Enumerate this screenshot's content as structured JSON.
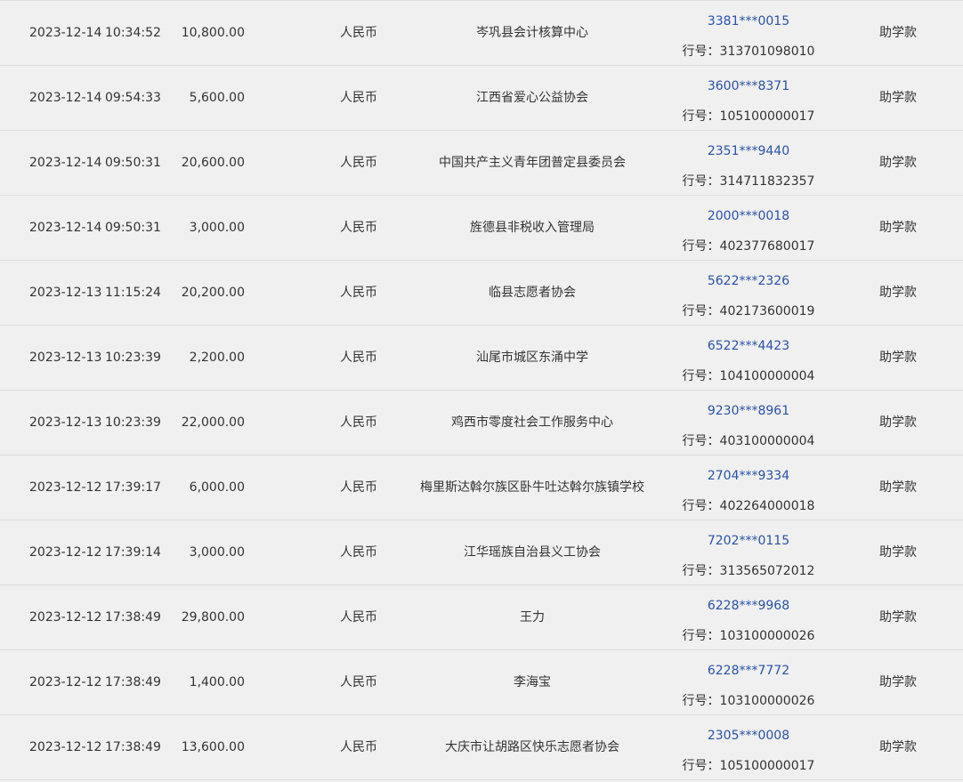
{
  "bank_label": "行号：",
  "colors": {
    "account_link": "#2852a8",
    "text": "#333333",
    "background": "#f0f0f0",
    "divider": "#dcdcdc"
  },
  "rows": [
    {
      "date": "2023-12-14",
      "time": "10:34:52",
      "amount": "10,800.00",
      "currency": "人民币",
      "name": "岑巩县会计核算中心",
      "account": "3381***0015",
      "bank_no": "313701098010",
      "purpose": "助学款"
    },
    {
      "date": "2023-12-14",
      "time": "09:54:33",
      "amount": "5,600.00",
      "currency": "人民币",
      "name": "江西省爱心公益协会",
      "account": "3600***8371",
      "bank_no": "105100000017",
      "purpose": "助学款"
    },
    {
      "date": "2023-12-14",
      "time": "09:50:31",
      "amount": "20,600.00",
      "currency": "人民币",
      "name": "中国共产主义青年团普定县委员会",
      "account": "2351***9440",
      "bank_no": "314711832357",
      "purpose": "助学款"
    },
    {
      "date": "2023-12-14",
      "time": "09:50:31",
      "amount": "3,000.00",
      "currency": "人民币",
      "name": "旌德县非税收入管理局",
      "account": "2000***0018",
      "bank_no": "402377680017",
      "purpose": "助学款"
    },
    {
      "date": "2023-12-13",
      "time": "11:15:24",
      "amount": "20,200.00",
      "currency": "人民币",
      "name": "临县志愿者协会",
      "account": "5622***2326",
      "bank_no": "402173600019",
      "purpose": "助学款"
    },
    {
      "date": "2023-12-13",
      "time": "10:23:39",
      "amount": "2,200.00",
      "currency": "人民币",
      "name": "汕尾市城区东涌中学",
      "account": "6522***4423",
      "bank_no": "104100000004",
      "purpose": "助学款"
    },
    {
      "date": "2023-12-13",
      "time": "10:23:39",
      "amount": "22,000.00",
      "currency": "人民币",
      "name": "鸡西市零度社会工作服务中心",
      "account": "9230***8961",
      "bank_no": "403100000004",
      "purpose": "助学款"
    },
    {
      "date": "2023-12-12",
      "time": "17:39:17",
      "amount": "6,000.00",
      "currency": "人民币",
      "name": "梅里斯达斡尔族区卧牛吐达斡尔族镇学校",
      "account": "2704***9334",
      "bank_no": "402264000018",
      "purpose": "助学款"
    },
    {
      "date": "2023-12-12",
      "time": "17:39:14",
      "amount": "3,000.00",
      "currency": "人民币",
      "name": "江华瑶族自治县义工协会",
      "account": "7202***0115",
      "bank_no": "313565072012",
      "purpose": "助学款"
    },
    {
      "date": "2023-12-12",
      "time": "17:38:49",
      "amount": "29,800.00",
      "currency": "人民币",
      "name": "王力",
      "account": "6228***9968",
      "bank_no": "103100000026",
      "purpose": "助学款"
    },
    {
      "date": "2023-12-12",
      "time": "17:38:49",
      "amount": "1,400.00",
      "currency": "人民币",
      "name": "李海宝",
      "account": "6228***7772",
      "bank_no": "103100000026",
      "purpose": "助学款"
    },
    {
      "date": "2023-12-12",
      "time": "17:38:49",
      "amount": "13,600.00",
      "currency": "人民币",
      "name": "大庆市让胡路区快乐志愿者协会",
      "account": "2305***0008",
      "bank_no": "105100000017",
      "purpose": "助学款"
    }
  ]
}
